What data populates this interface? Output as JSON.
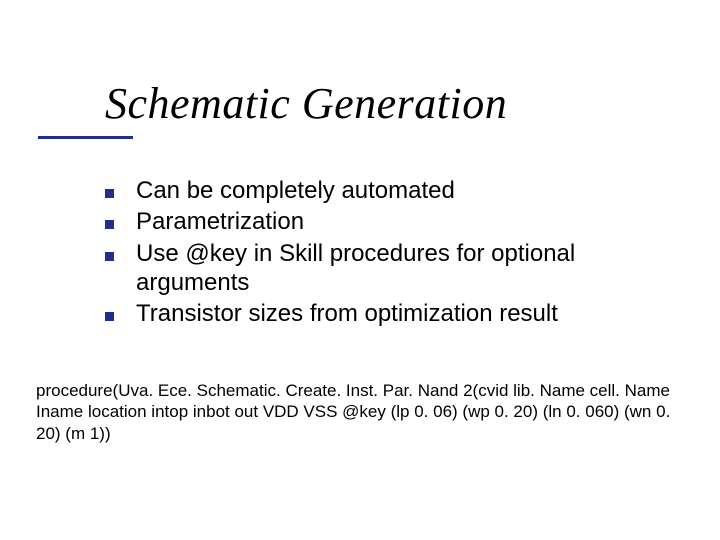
{
  "title": "Schematic Generation",
  "bullets": {
    "items": [
      {
        "text": "Can be completely automated"
      },
      {
        "text": "Parametrization"
      },
      {
        "text": "Use @key in Skill procedures for optional arguments"
      },
      {
        "text": "Transistor sizes from optimization result"
      }
    ]
  },
  "procedure": "procedure(Uva. Ece. Schematic. Create. Inst. Par. Nand 2(cvid lib. Name cell. Name Iname location intop inbot out VDD VSS @key (lp 0. 06) (wp 0. 20) (ln 0. 060) (wn 0. 20) (m 1))"
}
